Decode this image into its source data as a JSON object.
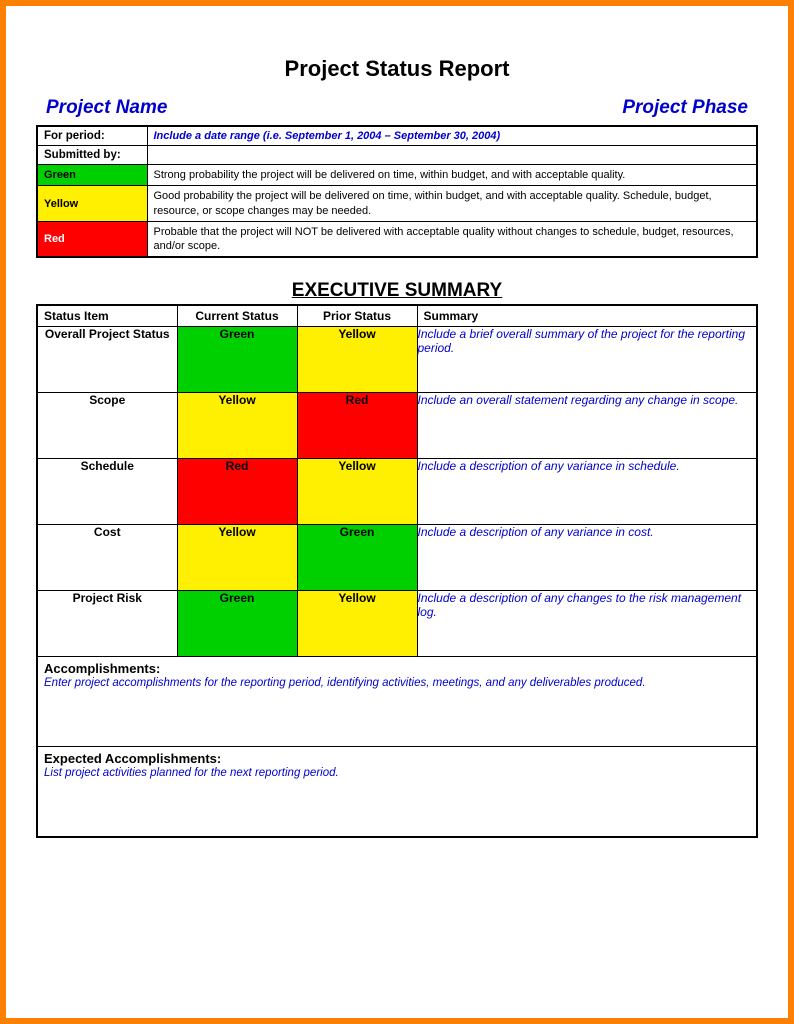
{
  "title": "Project Status Report",
  "header": {
    "project_name_label": "Project Name",
    "project_phase_label": "Project Phase"
  },
  "info": {
    "for_period_label": "For period:",
    "for_period_value": "Include a date range (i.e. September 1, 2004 – September 30, 2004)",
    "submitted_by_label": "Submitted by:",
    "submitted_by_value": ""
  },
  "legend": [
    {
      "name": "Green",
      "class": "bg-green",
      "desc": "Strong probability the project will be delivered on time, within budget, and with acceptable quality."
    },
    {
      "name": "Yellow",
      "class": "bg-yellow",
      "desc": "Good probability the project will be delivered on time, within budget, and with acceptable quality. Schedule, budget, resource, or scope changes may be needed."
    },
    {
      "name": "Red",
      "class": "bg-red",
      "desc": "Probable that the project will NOT be delivered with acceptable quality without changes to schedule, budget, resources, and/or scope."
    }
  ],
  "exec_summary": {
    "title": "EXECUTIVE SUMMARY",
    "headers": {
      "status_item": "Status Item",
      "current_status": "Current Status",
      "prior_status": "Prior Status",
      "summary": "Summary"
    },
    "rows": [
      {
        "item": "Overall Project Status",
        "current": "Green",
        "current_class": "bg-green",
        "prior": "Yellow",
        "prior_class": "bg-yellow",
        "summary": "Include a brief overall summary of the project for the reporting period."
      },
      {
        "item": "Scope",
        "current": "Yellow",
        "current_class": "bg-yellow",
        "prior": "Red",
        "prior_class": "bg-red",
        "summary": "Include an overall statement regarding any change in scope."
      },
      {
        "item": "Schedule",
        "current": "Red",
        "current_class": "bg-red",
        "prior": "Yellow",
        "prior_class": "bg-yellow",
        "summary": "Include a description of any variance in schedule."
      },
      {
        "item": "Cost",
        "current": "Yellow",
        "current_class": "bg-yellow",
        "prior": "Green",
        "prior_class": "bg-green",
        "summary": "Include a description of any variance in cost."
      },
      {
        "item": "Project Risk",
        "current": "Green",
        "current_class": "bg-green",
        "prior": "Yellow",
        "prior_class": "bg-yellow",
        "summary": "Include a description of any changes to the risk management log."
      }
    ],
    "accomplishments": {
      "title": "Accomplishments:",
      "text": "Enter project accomplishments for the reporting period, identifying activities, meetings, and any deliverables produced."
    },
    "expected": {
      "title": "Expected Accomplishments:",
      "text": "List project activities planned for the next reporting period."
    }
  },
  "colors": {
    "accent": "#ff7f00",
    "link_blue": "#0000cc"
  }
}
